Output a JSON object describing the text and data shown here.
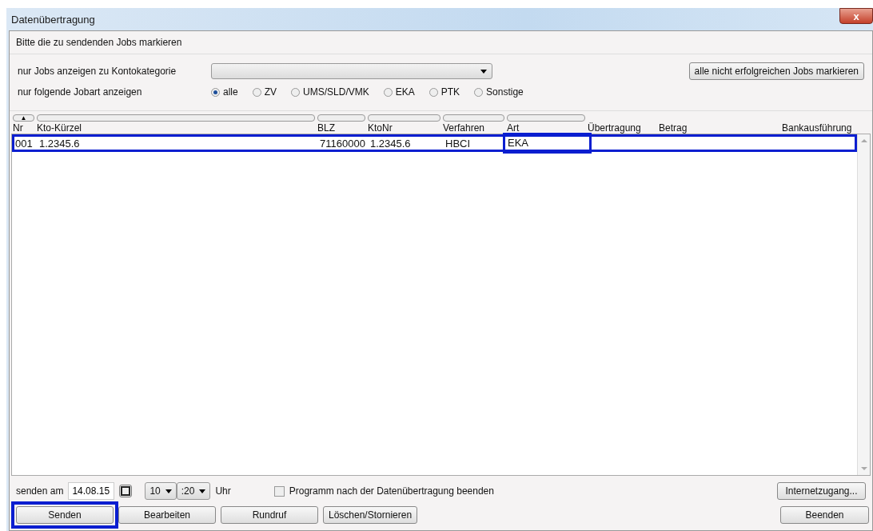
{
  "window": {
    "title": "Datenübertragung",
    "close": "x"
  },
  "instruction": "Bitte die zu sendenden Jobs markieren",
  "filter": {
    "category_label": "nur Jobs anzeigen zu Kontokategorie",
    "mark_button": "alle nicht erfolgreichen Jobs markieren",
    "jobtype_label": "nur folgende Jobart anzeigen",
    "jobtypes": [
      {
        "label": "alle",
        "selected": true
      },
      {
        "label": "ZV",
        "selected": false
      },
      {
        "label": "UMS/SLD/VMK",
        "selected": false
      },
      {
        "label": "EKA",
        "selected": false
      },
      {
        "label": "PTK",
        "selected": false
      },
      {
        "label": "Sonstige",
        "selected": false
      }
    ]
  },
  "table": {
    "sort_glyph": "▲",
    "columns": [
      "Nr",
      "Kto-Kürzel",
      "BLZ",
      "KtoNr",
      "Verfahren",
      "Art",
      "Übertragung",
      "Betrag",
      "Bankausführung"
    ],
    "rows": [
      {
        "cells": [
          {
            "text": "001",
            "highlighted": false
          },
          {
            "text": "1.2345.6",
            "highlighted": false
          },
          {
            "text": "71160000",
            "highlighted": false
          },
          {
            "text": "1.2345.6",
            "highlighted": false
          },
          {
            "text": "HBCI",
            "highlighted": false
          },
          {
            "text": "EKA",
            "highlighted": true
          }
        ],
        "highlighted": true
      }
    ]
  },
  "schedule": {
    "label": "senden am",
    "date": "14.08.15",
    "hour": "10",
    "minute": ":20",
    "unit": "Uhr",
    "exit_label": "Programm nach der Datenübertragung beenden",
    "exit_checked": false,
    "internet_button": "Internetzugang..."
  },
  "buttons": [
    {
      "label": "Senden",
      "highlighted": true
    },
    {
      "label": "Bearbeiten",
      "highlighted": false
    },
    {
      "label": "Rundruf",
      "highlighted": false
    },
    {
      "label": "Löschen/Stornieren",
      "highlighted": false
    }
  ],
  "close_button": "Beenden"
}
